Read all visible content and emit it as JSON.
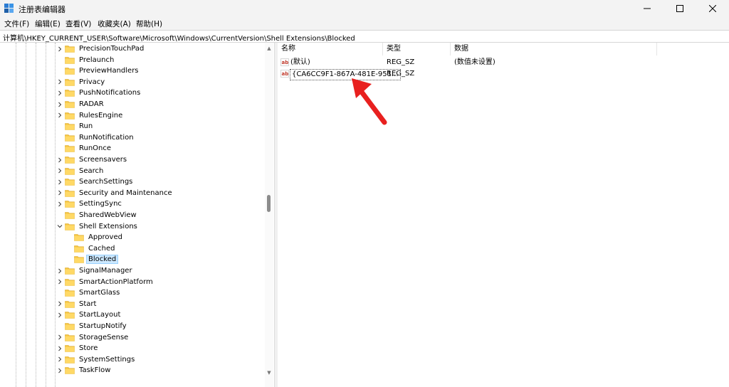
{
  "window": {
    "title": "注册表编辑器",
    "controls": {
      "minimize": "minimize-icon",
      "maximize": "maximize-icon",
      "close": "close-icon"
    }
  },
  "menu": [
    "文件(F)",
    "编辑(E)",
    "查看(V)",
    "收藏夹(A)",
    "帮助(H)"
  ],
  "address": "计算机\\HKEY_CURRENT_USER\\Software\\Microsoft\\Windows\\CurrentVersion\\Shell Extensions\\Blocked",
  "tree": {
    "items": [
      {
        "label": "PrecisionTouchPad",
        "expandable": true
      },
      {
        "label": "Prelaunch",
        "expandable": false
      },
      {
        "label": "PreviewHandlers",
        "expandable": false
      },
      {
        "label": "Privacy",
        "expandable": true
      },
      {
        "label": "PushNotifications",
        "expandable": true
      },
      {
        "label": "RADAR",
        "expandable": true
      },
      {
        "label": "RulesEngine",
        "expandable": true
      },
      {
        "label": "Run",
        "expandable": false
      },
      {
        "label": "RunNotification",
        "expandable": false
      },
      {
        "label": "RunOnce",
        "expandable": false
      },
      {
        "label": "Screensavers",
        "expandable": true
      },
      {
        "label": "Search",
        "expandable": true
      },
      {
        "label": "SearchSettings",
        "expandable": true
      },
      {
        "label": "Security and Maintenance",
        "expandable": true
      },
      {
        "label": "SettingSync",
        "expandable": true
      },
      {
        "label": "SharedWebView",
        "expandable": false
      },
      {
        "label": "Shell Extensions",
        "expandable": true,
        "expanded": true
      },
      {
        "label": "Approved",
        "expandable": false,
        "child": true
      },
      {
        "label": "Cached",
        "expandable": false,
        "child": true
      },
      {
        "label": "Blocked",
        "expandable": false,
        "child": true,
        "selected": true
      },
      {
        "label": "SignalManager",
        "expandable": true
      },
      {
        "label": "SmartActionPlatform",
        "expandable": true
      },
      {
        "label": "SmartGlass",
        "expandable": false
      },
      {
        "label": "Start",
        "expandable": true
      },
      {
        "label": "StartLayout",
        "expandable": true
      },
      {
        "label": "StartupNotify",
        "expandable": false
      },
      {
        "label": "StorageSense",
        "expandable": true
      },
      {
        "label": "Store",
        "expandable": true
      },
      {
        "label": "SystemSettings",
        "expandable": true
      },
      {
        "label": "TaskFlow",
        "expandable": true
      }
    ]
  },
  "list": {
    "columns": [
      "名称",
      "类型",
      "数据"
    ],
    "rows": [
      {
        "name": "(默认)",
        "type": "REG_SZ",
        "data": "(数值未设置)"
      },
      {
        "name": "{CA6CC9F1-867A-481E-951...",
        "type": "REG_SZ",
        "data": ""
      }
    ]
  },
  "colors": {
    "folder": "#f5c542",
    "arrow": "#e8201f",
    "selection": "#cce8ff",
    "ab_icon": "#c0392b"
  },
  "annotation": {
    "icon": "red-arrow-icon"
  }
}
